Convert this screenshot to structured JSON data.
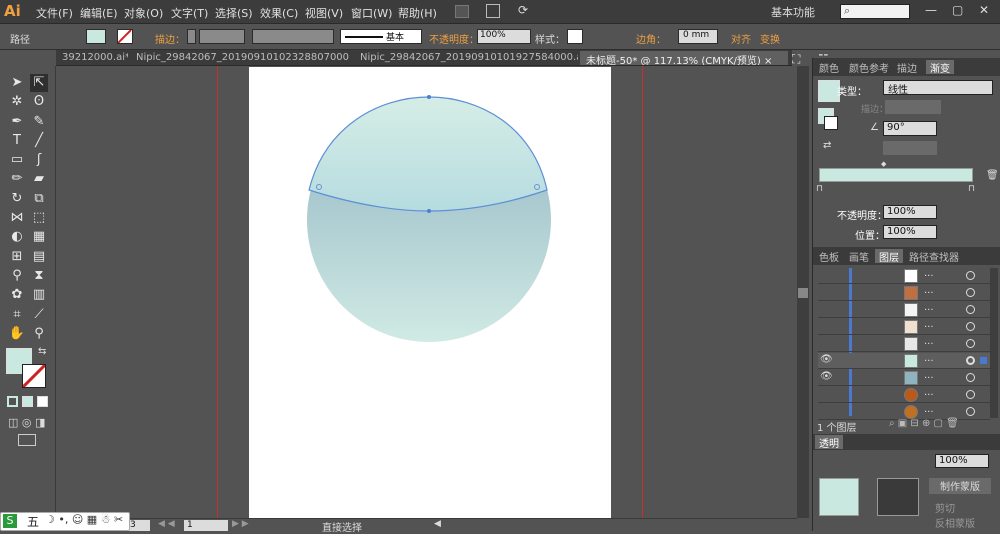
{
  "app": {
    "logo": "Ai",
    "workspace": "基本功能",
    "search_placeholder": ""
  },
  "menu": [
    "文件(F)",
    "编辑(E)",
    "对象(O)",
    "文字(T)",
    "选择(S)",
    "效果(C)",
    "视图(V)",
    "窗口(W)",
    "帮助(H)"
  ],
  "control": {
    "object_type": "路径",
    "stroke_label": "描边：",
    "stroke_style": "基本",
    "opacity_label": "不透明度：",
    "opacity_value": "100%",
    "style_label": "样式：",
    "corner_label": "边角：",
    "corner_value": "0 mm",
    "align_label": "对齐",
    "transform_label": "变换"
  },
  "tabs": [
    {
      "label": "39212000.ai* ×",
      "active": false
    },
    {
      "label": "Nipic_29842067_20190910102328807000.ai* ×",
      "active": false
    },
    {
      "label": "Nipic_29842067_20190910101927584000.ai* ×",
      "active": false
    },
    {
      "label": "未标题-50* @ 117.13% (CMYK/预览) ×",
      "active": true
    }
  ],
  "gradient_panel": {
    "tabs": [
      "颜色",
      "颜色参考",
      "描边",
      "渐变"
    ],
    "type_label": "类型：",
    "type_value": "线性",
    "stroke_label": "描边：",
    "angle_value": "90°",
    "opacity_label": "不透明度：",
    "opacity_value": "100%",
    "location_label": "位置：",
    "location_value": "100%",
    "stop_color_left": "#c8e8e0",
    "stop_color_right": "#c8e8e0"
  },
  "layers_panel": {
    "tabs": [
      "色板",
      "画笔",
      "图层",
      "路径查找器"
    ],
    "rows": [
      {
        "dots": "...",
        "thumb": "#ffffff",
        "eye": ""
      },
      {
        "dots": "...",
        "thumb": "#c07040",
        "eye": ""
      },
      {
        "dots": "...",
        "thumb": "#f4f4f4",
        "eye": ""
      },
      {
        "dots": "...",
        "thumb": "#f0e0d0",
        "eye": ""
      },
      {
        "dots": "...",
        "thumb": "#e8e8e8",
        "eye": ""
      },
      {
        "dots": "...",
        "thumb": "#c8e8e0",
        "eye": "👁"
      },
      {
        "dots": "...",
        "thumb": "#8fb4c0",
        "eye": "👁"
      },
      {
        "dots": "...",
        "thumb": "#b85a1a",
        "eye": ""
      },
      {
        "dots": "...",
        "thumb": "#c07020",
        "eye": ""
      }
    ],
    "count_label": "1 个图层"
  },
  "transparency": {
    "tab": "透明",
    "opacity_value": "100%",
    "make_mask": "制作蒙版",
    "clip": "剪切",
    "invert_mask": "反相蒙版"
  },
  "status": {
    "zoom": "3",
    "page": "1",
    "tool": "直接选择"
  },
  "ime": {
    "label": "五"
  },
  "colors": {
    "accent": "#f0a040",
    "fill": "#c8e8e0",
    "guide": "#c83030"
  }
}
